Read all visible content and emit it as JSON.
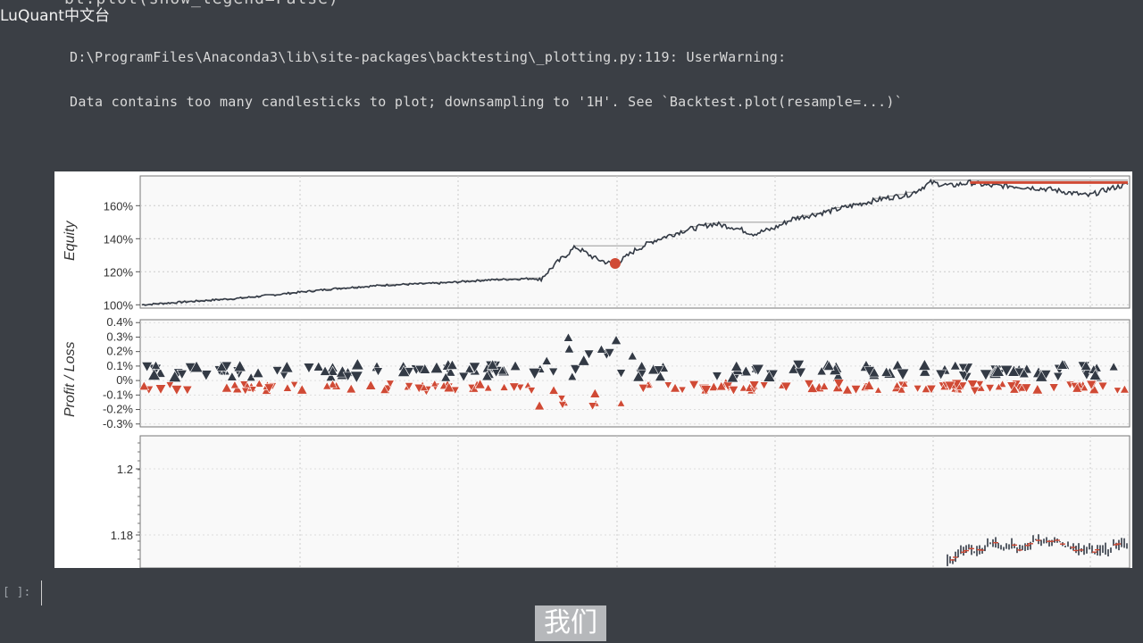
{
  "notebook": {
    "top_clipped_line": "bt.plot(show_legend=False)",
    "watermark": "LuQuant中文台",
    "warning_line1": "D:\\ProgramFiles\\Anaconda3\\lib\\site-packages\\backtesting\\_plotting.py:119: UserWarning:",
    "warning_line2": "Data contains too many candlesticks to plot; downsampling to '1H'. See `Backtest.plot(resample=...)`",
    "prompt": "[ ]:",
    "subtitle": "我们"
  },
  "colors": {
    "accent": "#d04a35",
    "series": "#333a45",
    "background": "#3b3f45"
  },
  "chart_data": [
    {
      "type": "line",
      "ylabel": "Equity",
      "y_ticks": [
        "100%",
        "120%",
        "140%",
        "160%"
      ],
      "ylim": [
        98,
        178
      ],
      "x": [
        0,
        0.05,
        0.1,
        0.15,
        0.2,
        0.25,
        0.3,
        0.35,
        0.4,
        0.4,
        0.42,
        0.44,
        0.46,
        0.48,
        0.5,
        0.52,
        0.55,
        0.58,
        0.6,
        0.62,
        0.64,
        0.66,
        0.7,
        0.72,
        0.75,
        0.78,
        0.8,
        0.82,
        0.84,
        0.86,
        0.88,
        0.9,
        0.92,
        0.94,
        0.96,
        0.98,
        1.0
      ],
      "values": [
        100,
        102,
        104,
        107,
        110,
        112,
        113,
        115,
        116,
        113,
        125,
        135,
        128,
        124,
        133,
        139,
        145,
        149,
        147,
        143,
        146,
        152,
        157,
        160,
        164,
        167,
        174,
        172,
        174,
        172,
        172,
        171,
        170,
        168,
        166,
        170,
        173
      ],
      "max_drawdown_marker": {
        "x": 0.48,
        "y": 125
      },
      "peak_line": {
        "x_start": 0.84,
        "x_end": 1.0,
        "y": 174
      }
    },
    {
      "type": "scatter",
      "ylabel": "Profit / Loss",
      "y_ticks": [
        "0.4%",
        "0.3%",
        "0.2%",
        "0.1%",
        "0%",
        "-0.1%",
        "-0.2%",
        "-0.3%"
      ],
      "ylim": [
        -0.32,
        0.42
      ],
      "series": [
        {
          "marker": "triangle",
          "color": "#333a45",
          "sign": "profit"
        },
        {
          "marker": "triangle",
          "color": "#d04a35",
          "sign": "loss"
        }
      ]
    },
    {
      "type": "candlestick",
      "y_ticks": [
        "1.2",
        "1.18"
      ],
      "ylim": [
        1.17,
        1.21
      ]
    }
  ]
}
